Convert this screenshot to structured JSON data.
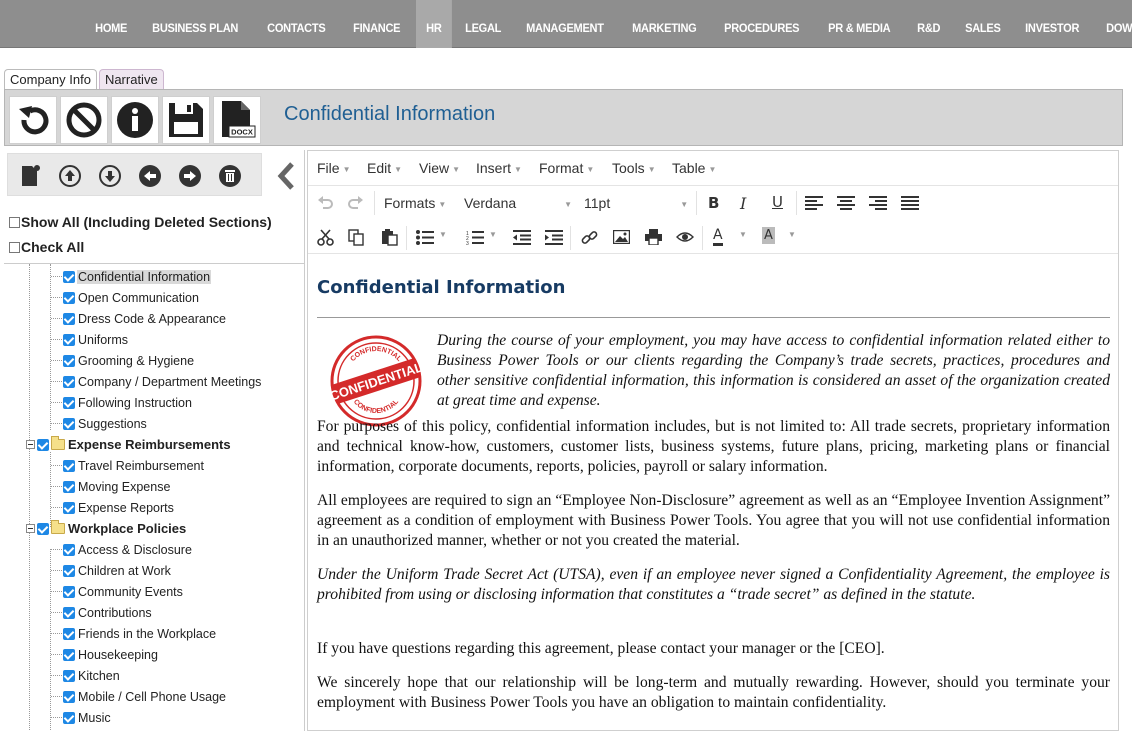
{
  "nav": {
    "items": [
      "HOME",
      "BUSINESS PLAN",
      "CONTACTS",
      "FINANCE",
      "HR",
      "LEGAL",
      "MANAGEMENT",
      "MARKETING",
      "PROCEDURES",
      "PR & MEDIA",
      "R&D",
      "SALES",
      "INVESTOR",
      "DOWNLOADS"
    ],
    "active": "HR"
  },
  "tabs": {
    "company_info": "Company Info",
    "narrative": "Narrative"
  },
  "toolbar": {
    "docx_label": "DOCX",
    "title": "Confidential Information"
  },
  "left": {
    "show_all": "Show All (Including Deleted Sections)",
    "check_all": "Check All",
    "tree": [
      {
        "label": "Confidential Information",
        "level": 1
      },
      {
        "label": "Open Communication",
        "level": 1
      },
      {
        "label": "Dress Code & Appearance",
        "level": 1
      },
      {
        "label": "Uniforms",
        "level": 1
      },
      {
        "label": "Grooming & Hygiene",
        "level": 1
      },
      {
        "label": "Company / Department Meetings",
        "level": 1
      },
      {
        "label": "Following Instruction",
        "level": 1
      },
      {
        "label": "Suggestions",
        "level": 1
      },
      {
        "label": "Expense Reimbursements",
        "level": 0
      },
      {
        "label": "Travel Reimbursement",
        "level": 1
      },
      {
        "label": "Moving Expense",
        "level": 1
      },
      {
        "label": "Expense Reports",
        "level": 1
      },
      {
        "label": "Workplace Policies",
        "level": 0
      },
      {
        "label": "Access & Disclosure",
        "level": 1
      },
      {
        "label": "Children at Work",
        "level": 1
      },
      {
        "label": "Community Events",
        "level": 1
      },
      {
        "label": "Contributions",
        "level": 1
      },
      {
        "label": "Friends in the Workplace",
        "level": 1
      },
      {
        "label": "Housekeeping",
        "level": 1
      },
      {
        "label": "Kitchen",
        "level": 1
      },
      {
        "label": "Mobile / Cell Phone Usage",
        "level": 1
      },
      {
        "label": "Music",
        "level": 1
      }
    ],
    "selected_index": 0
  },
  "editor": {
    "menus": [
      "File",
      "Edit",
      "View",
      "Insert",
      "Format",
      "Tools",
      "Table"
    ],
    "formats_label": "Formats",
    "font_family": "Verdana",
    "font_size": "11pt",
    "stamp_text": "CONFIDENTIAL",
    "stamp_ring_text": "CONFIDENTIAL",
    "heading": "Confidential Information",
    "paragraphs": [
      "During the course of your employment, you may have access to confidential information related either to Business Power Tools or our clients regarding the Company’s trade secrets, practices, procedures and other sensitive confidential information, this information is considered an asset of the organization created at great time and expense.",
      "For purposes of this policy, confidential information includes, but is not limited to: All trade secrets, proprietary information and technical know-how, customers, customer lists, business systems, future plans, pricing, marketing plans or financial information, corporate documents, reports, policies, payroll or salary information.",
      "All employees are required to sign an “Employee Non-Disclosure” agreement as well as an “Employee Invention Assignment” agreement as a condition of employment with Business Power Tools. You agree that you will not use confidential information in an unauthorized manner, whether or not you created the material.",
      "Under the Uniform Trade Secret Act (UTSA), even if an employee never signed a Confidentiality Agreement, the employee is prohibited from using or disclosing information that constitutes a “trade secret” as defined in the statute.",
      "If you have questions regarding this agreement, please contact your manager or the [CEO].",
      "We sincerely hope that our relationship will be long-term and mutually rewarding. However, should you terminate your employment with Business Power Tools you have an obligation to maintain confidentiality."
    ]
  },
  "colors": {
    "nav_bg": "#8e8e8e",
    "title_blue": "#1f5f93",
    "check_blue": "#1e88e5",
    "stamp_red": "#d42a2a"
  }
}
